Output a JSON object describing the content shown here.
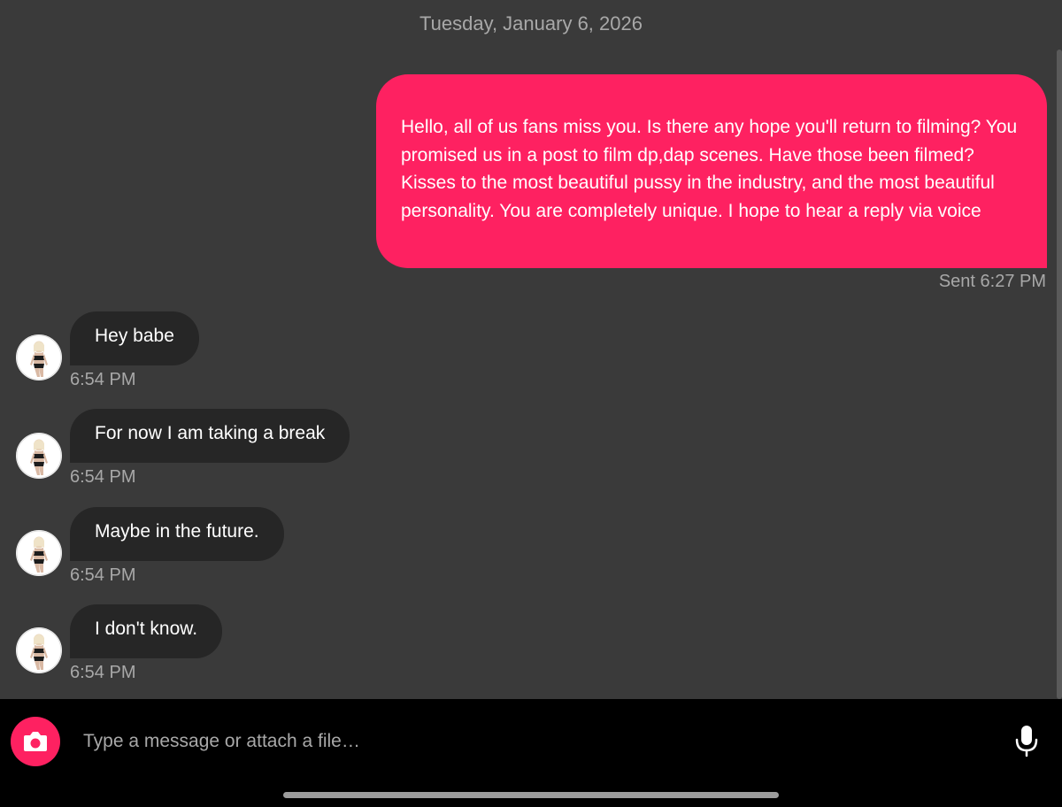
{
  "conversation": {
    "date_header": "Tuesday, January 6, 2026"
  },
  "sent_message": {
    "text": "Hello, all of us fans miss you. Is there any hope you'll return to filming? You promised us in a post to film dp,dap scenes. Have those been filmed? Kisses to the most beautiful pussy in the industry, and the most beautiful personality. You are completely unique. I hope to hear a reply via voice",
    "meta": "Sent 6:27 PM"
  },
  "received_messages": [
    {
      "text": "Hey babe",
      "time": "6:54 PM"
    },
    {
      "text": "For now I am taking a break",
      "time": "6:54 PM"
    },
    {
      "text": "Maybe in the future.",
      "time": "6:54 PM"
    },
    {
      "text": "I don't know.",
      "time": "6:54 PM"
    }
  ],
  "composer": {
    "placeholder": "Type a message or attach a file…",
    "camera_icon": "camera-icon",
    "mic_icon": "microphone-icon"
  },
  "colors": {
    "background": "#3a3a3a",
    "sent_bubble": "#fe2161",
    "received_bubble": "#262626",
    "accent": "#fe2161",
    "meta_text": "#a8a8a8",
    "composer_bar": "#000000"
  }
}
